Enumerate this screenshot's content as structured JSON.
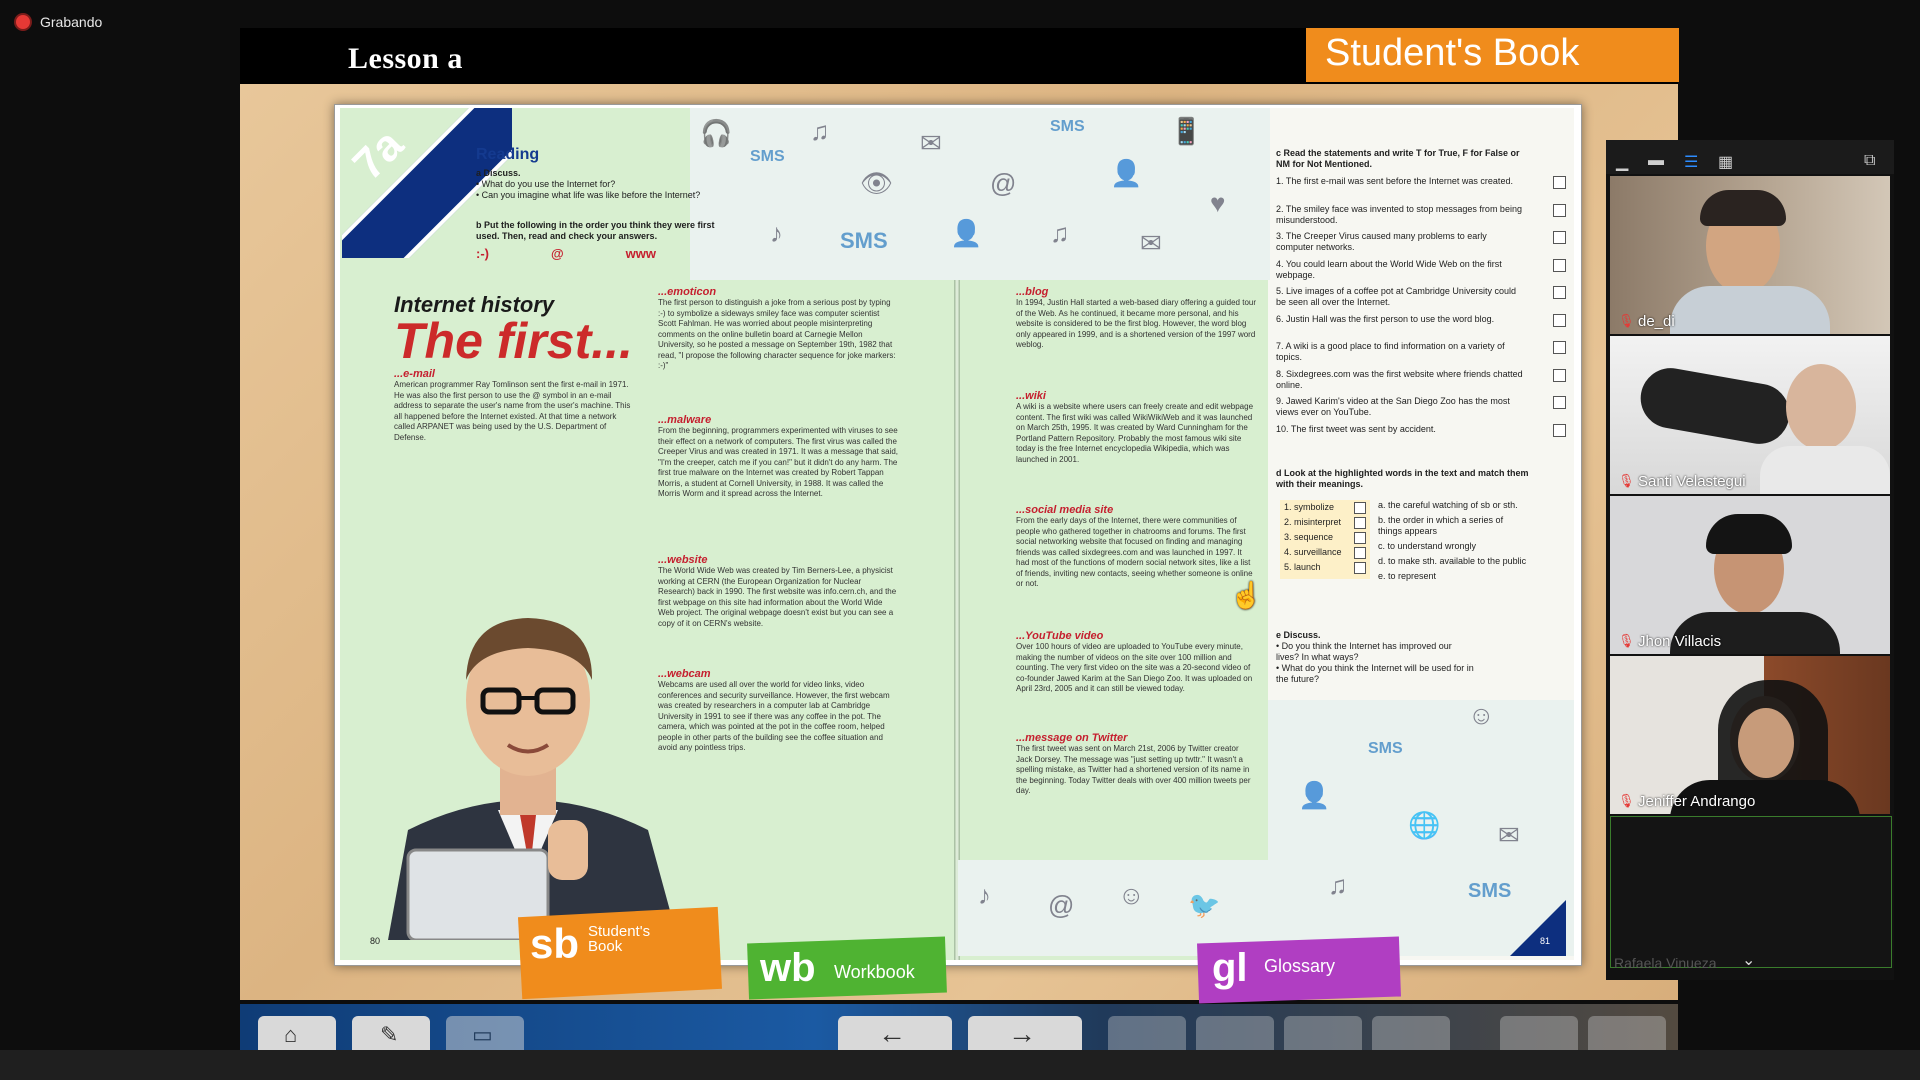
{
  "recording": {
    "label": "Grabando",
    "color": "#e53935"
  },
  "lesson_title": "Lesson a",
  "student_book_header": "Student's Book",
  "book": {
    "unit_badge": "7a",
    "reading_title": "Reading",
    "discuss_a": {
      "heading": "a  Discuss.",
      "items": [
        "• What do you use the Internet for?",
        "• Can you imagine what life was like before the Internet?"
      ]
    },
    "task_b": "b  Put the following in the order you think they were first used. Then, read and check your answers.",
    "symbols": [
      ":-)",
      "@",
      "www"
    ],
    "internet_history_title": "Internet history",
    "internet_history_big": "The first...",
    "sections": [
      {
        "title": "...e-mail",
        "text": "American programmer Ray Tomlinson sent the first e-mail in 1971. He was also the first person to use the @ symbol in an e-mail address to separate the user's name from the user's machine. This all happened before the Internet existed. At that time a network called ARPANET was being used by the U.S. Department of Defense."
      },
      {
        "title": "...emoticon",
        "text": "The first person to distinguish a joke from a serious post by typing :-) to symbolize a sideways smiley face was computer scientist Scott Fahlman. He was worried about people misinterpreting comments on the online bulletin board at Carnegie Mellon University, so he posted a message on September 19th, 1982 that read, \"I propose the following character sequence for joke markers: :-)\""
      },
      {
        "title": "...malware",
        "text": "From the beginning, programmers experimented with viruses to see their effect on a network of computers. The first virus was called the Creeper Virus and was created in 1971. It was a message that said, \"I'm the creeper, catch me if you can!\" but it didn't do any harm. The first true malware on the Internet was created by Robert Tappan Morris, a student at Cornell University, in 1988. It was called the Morris Worm and it spread across the Internet."
      },
      {
        "title": "...website",
        "text": "The World Wide Web was created by Tim Berners-Lee, a physicist working at CERN (the European Organization for Nuclear Research) back in 1990. The first website was info.cern.ch, and the first webpage on this site had information about the World Wide Web project. The original webpage doesn't exist but you can see a copy of it on CERN's website."
      },
      {
        "title": "...webcam",
        "text": "Webcams are used all over the world for video links, video conferences and security surveillance. However, the first webcam was created by researchers in a computer lab at Cambridge University in 1991 to see if there was any coffee in the pot. The camera, which was pointed at the pot in the coffee room, helped people in other parts of the building see the coffee situation and avoid any pointless trips."
      },
      {
        "title": "...blog",
        "text": "In 1994, Justin Hall started a web-based diary offering a guided tour of the Web. As he continued, it became more personal, and his website is considered to be the first blog. However, the word blog only appeared in 1999, and is a shortened version of the 1997 word weblog."
      },
      {
        "title": "...wiki",
        "text": "A wiki is a website where users can freely create and edit webpage content. The first wiki was called WikiWikiWeb and it was launched on March 25th, 1995. It was created by Ward Cunningham for the Portland Pattern Repository. Probably the most famous wiki site today is the free Internet encyclopedia Wikipedia, which was launched in 2001."
      },
      {
        "title": "...social media site",
        "text": "From the early days of the Internet, there were communities of people who gathered together in chatrooms and forums. The first social networking website that focused on finding and managing friends was called sixdegrees.com and was launched in 1997. It had most of the functions of modern social network sites, like a list of friends, inviting new contacts, seeing whether someone is online or not."
      },
      {
        "title": "...YouTube video",
        "text": "Over 100 hours of video are uploaded to YouTube every minute, making the number of videos on the site over 100 million and counting. The very first video on the site was a 20-second video of co-founder Jawed Karim at the San Diego Zoo. It was uploaded on April 23rd, 2005 and it can still be viewed today."
      },
      {
        "title": "...message on Twitter",
        "text": "The first tweet was sent on March 21st, 2006 by Twitter creator Jack Dorsey. The message was \"just setting up twttr.\" It wasn't a spelling mistake, as Twitter had a shortened version of its name in the beginning. Today Twitter deals with over 400 million tweets per day."
      }
    ],
    "task_c": {
      "heading": "c  Read the statements and write T for True, F for False or NM for Not Mentioned.",
      "items": [
        "1.  The first e-mail was sent before the Internet was created.",
        "2.  The smiley face was invented to stop messages from being misunderstood.",
        "3.  The Creeper Virus caused many problems to early computer networks.",
        "4.  You could learn about the World Wide Web on the first webpage.",
        "5.  Live images of a coffee pot at Cambridge University could be seen all over the Internet.",
        "6.  Justin Hall was the first person to use the word blog.",
        "7.  A wiki is a good place to find information on a variety of topics.",
        "8.  Sixdegrees.com was the first website where friends chatted online.",
        "9.  Jawed Karim's video at the San Diego Zoo has the most views ever on YouTube.",
        "10.  The first tweet was sent by accident."
      ]
    },
    "task_d": {
      "heading": "d  Look at the highlighted words in the text and match them with their meanings.",
      "words": [
        "1.  symbolize",
        "2.  misinterpret",
        "3.  sequence",
        "4.  surveillance",
        "5.  launch"
      ],
      "meanings": [
        "a.  the careful watching of sb or sth.",
        "b.  the order in which a series of things appears",
        "c.  to understand wrongly",
        "d.  to make sth. available to the public",
        "e.  to represent"
      ]
    },
    "task_e": {
      "heading": "e  Discuss.",
      "items": [
        "• Do you think the Internet has improved our lives? In what ways?",
        "• What do you think the Internet will be used for in the future?"
      ]
    },
    "page_numbers": [
      "80",
      "81"
    ],
    "tabs": [
      {
        "abbr": "sb",
        "label": "Student's Book",
        "color": "#f08c1c"
      },
      {
        "abbr": "wb",
        "label": "Workbook",
        "color": "#4fb332"
      },
      {
        "abbr": "gl",
        "label": "Glossary",
        "color": "#b03ec2"
      }
    ]
  },
  "participants": [
    {
      "name": "de_di"
    },
    {
      "name": "Santi Velastegui"
    },
    {
      "name": "Jhon Villacis"
    },
    {
      "name": "Jeniffer Andrango"
    },
    {
      "name": "Rafaela Vinueza"
    }
  ],
  "toolbar_icons": [
    "home-icon",
    "pen-icon",
    "screen-icon",
    "back-arrow-icon",
    "forward-arrow-icon"
  ]
}
